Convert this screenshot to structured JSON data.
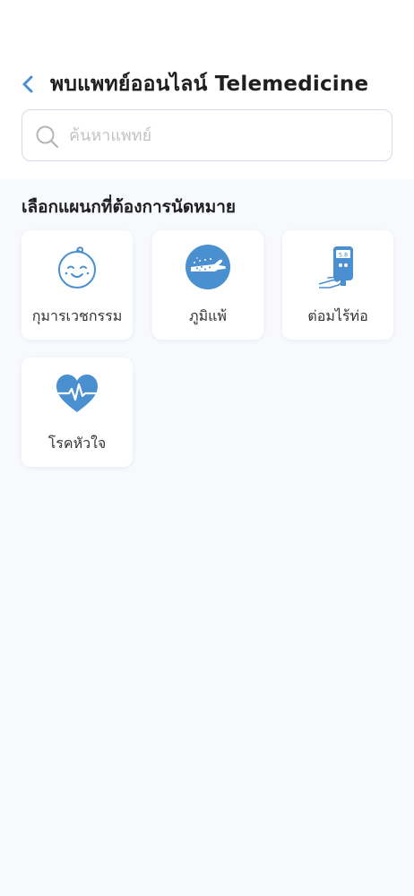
{
  "header": {
    "title": "พบแพทย์ออนไลน์ Telemedicine",
    "back_icon": "chevron-left-icon"
  },
  "search": {
    "placeholder": "ค้นหาแพทย์",
    "value": "",
    "icon": "search-icon"
  },
  "section": {
    "title": "เลือกแผนกที่ต้องการนัดหมาย"
  },
  "departments": [
    {
      "label": "กุมารเวชกรรม",
      "icon": "baby-face-icon"
    },
    {
      "label": "ภูมิแพ้",
      "icon": "allergy-arm-icon"
    },
    {
      "label": "ต่อมไร้ท่อ",
      "icon": "glucose-meter-icon",
      "meter_reading": "5.8"
    },
    {
      "label": "โรคหัวใจ",
      "icon": "heart-pulse-icon"
    }
  ],
  "colors": {
    "accent": "#4a8fcf",
    "text": "#1f1f1f",
    "page_background": "#f7f9fd",
    "search_border": "#dcd7ea"
  }
}
